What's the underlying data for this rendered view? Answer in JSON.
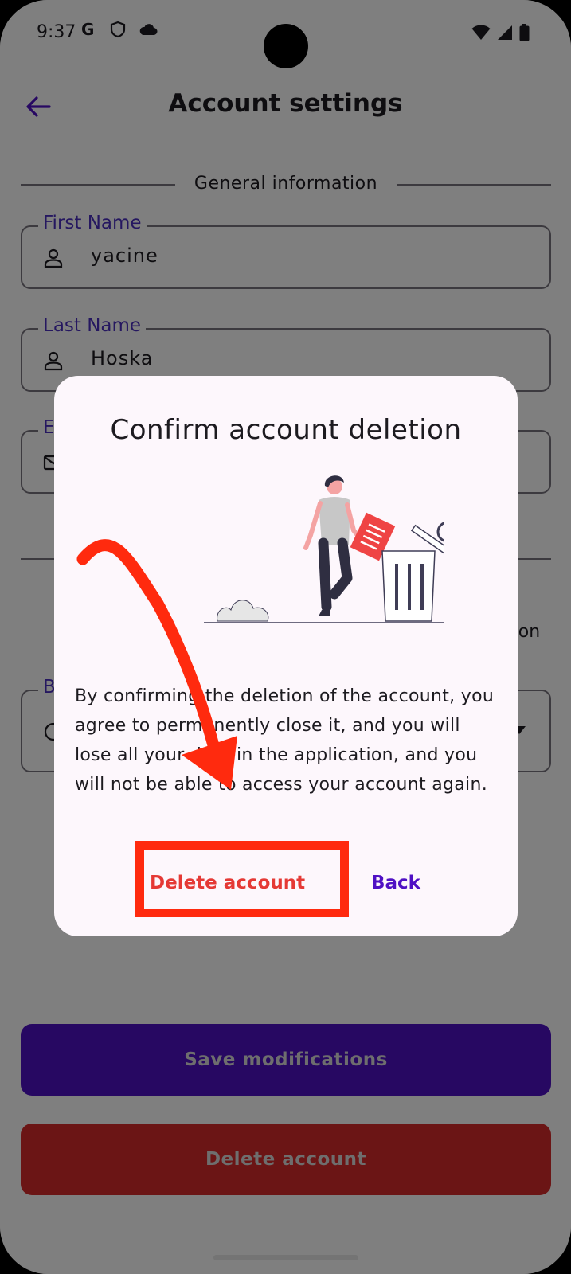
{
  "status_bar": {
    "time": "9:37"
  },
  "app_bar": {
    "title": "Account settings"
  },
  "section": {
    "label": "General information"
  },
  "fields": {
    "first_name": {
      "label": "First Name",
      "value": "yacine"
    },
    "last_name": {
      "label": "Last Name",
      "value": "Hoska"
    },
    "email": {
      "label": "E"
    },
    "birth": {
      "label": "B"
    }
  },
  "partial": {
    "right_text": "tion"
  },
  "buttons": {
    "save": "Save modifications",
    "delete": "Delete account"
  },
  "dialog": {
    "title": "Confirm account deletion",
    "body": "By confirming the deletion of the account, you agree to permanently close it, and you will lose all your data in the application, and you will not be able to access your account again.",
    "delete_label": "Delete account",
    "back_label": "Back"
  },
  "colors": {
    "accent": "#4f10c4",
    "danger": "#d72b2b",
    "annotation": "#ff2a0e"
  }
}
